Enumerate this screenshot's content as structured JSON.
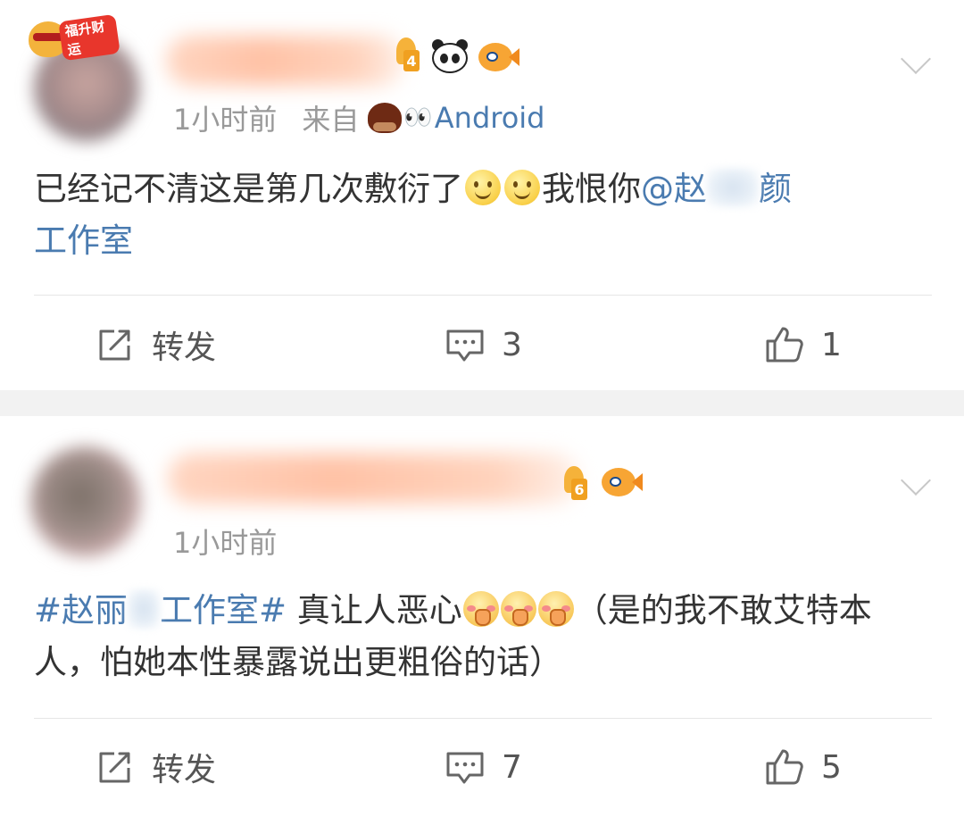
{
  "posts": [
    {
      "time": "1小时前",
      "source_prefix": "来自",
      "source_name": "Android",
      "level": "4",
      "upgrade_badge": "福升财运",
      "text_parts": [
        "已经记不清这是第几次敷衍了",
        "我恨你",
        "@赵",
        "颜",
        "工作室"
      ],
      "actions": {
        "repost_label": "转发",
        "comment_count": "3",
        "like_count": "1"
      }
    },
    {
      "time": "1小时前",
      "level": "6",
      "text_parts": [
        "#赵丽",
        "工作室#",
        " 真让人恶心",
        "（是的我不敢艾特本人，怕她本性暴露说出更粗俗的话）"
      ],
      "actions": {
        "repost_label": "转发",
        "comment_count": "7",
        "like_count": "5"
      }
    }
  ],
  "icons": {
    "expand": "chevron-down-icon",
    "repost": "share-square-icon",
    "comment": "comment-bubble-icon",
    "like": "thumbs-up-icon"
  },
  "colors": {
    "link": "#4a7bb0",
    "meta": "#999999",
    "separator": "#f2f2f2"
  }
}
